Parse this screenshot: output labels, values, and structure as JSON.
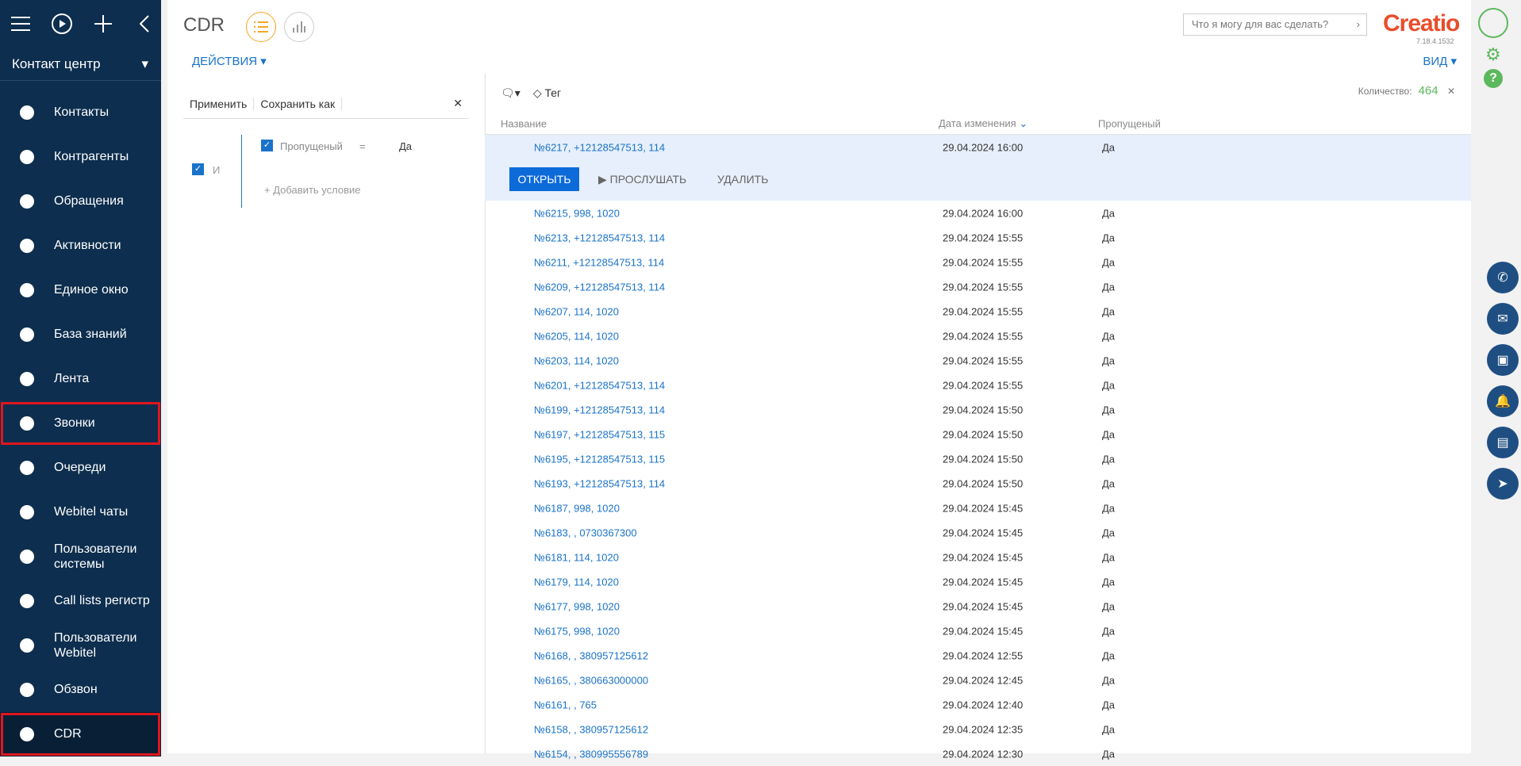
{
  "workspace": "Контакт центр",
  "nav": [
    {
      "label": "Контакты",
      "icon": "person-icon"
    },
    {
      "label": "Контрагенты",
      "icon": "building-icon"
    },
    {
      "label": "Обращения",
      "icon": "exclamation-icon"
    },
    {
      "label": "Активности",
      "icon": "flag-icon"
    },
    {
      "label": "Единое окно",
      "icon": "person-window-icon"
    },
    {
      "label": "База знаний",
      "icon": "book-icon"
    },
    {
      "label": "Лента",
      "icon": "chat-icon"
    },
    {
      "label": "Звонки",
      "icon": "phone-icon"
    },
    {
      "label": "Очереди",
      "icon": "queue-icon"
    },
    {
      "label": "Webitel чаты",
      "icon": "send-icon"
    },
    {
      "label": "Пользователи системы",
      "icon": "user-icon"
    },
    {
      "label": "Call lists регистр",
      "icon": "phone-list-icon"
    },
    {
      "label": "Пользователи Webitel",
      "icon": "users-icon"
    },
    {
      "label": "Обзвон",
      "icon": "dial-icon"
    },
    {
      "label": "CDR",
      "icon": "cdr-icon"
    }
  ],
  "page": {
    "title": "CDR",
    "actions": "ДЕЙСТВИЯ",
    "view": "ВИД",
    "search_placeholder": "Что я могу для вас сделать?",
    "logo": "Creatio",
    "version": "7.18.4.1532"
  },
  "filter": {
    "apply": "Применить",
    "save_as": "Сохранить как",
    "cond_field": "Пропущеный",
    "cond_op": "=",
    "cond_value": "Да",
    "group": "И",
    "add": "Добавить условие"
  },
  "grid": {
    "tag": "Тег",
    "count_label": "Количество:",
    "count": "464",
    "cols": [
      "Название",
      "Дата изменения",
      "Пропущеный"
    ],
    "open": "ОТКРЫТЬ",
    "listen": "ПРОСЛУШАТЬ",
    "delete": "УДАЛИТЬ",
    "rows": [
      [
        "№6217, +12128547513, 114",
        "29.04.2024 16:00",
        "Да"
      ],
      [
        "№6215, 998, 1020",
        "29.04.2024 16:00",
        "Да"
      ],
      [
        "№6213, +12128547513, 114",
        "29.04.2024 15:55",
        "Да"
      ],
      [
        "№6211, +12128547513, 114",
        "29.04.2024 15:55",
        "Да"
      ],
      [
        "№6209, +12128547513, 114",
        "29.04.2024 15:55",
        "Да"
      ],
      [
        "№6207, 114, 1020",
        "29.04.2024 15:55",
        "Да"
      ],
      [
        "№6205, 114, 1020",
        "29.04.2024 15:55",
        "Да"
      ],
      [
        "№6203, 114, 1020",
        "29.04.2024 15:55",
        "Да"
      ],
      [
        "№6201, +12128547513, 114",
        "29.04.2024 15:55",
        "Да"
      ],
      [
        "№6199, +12128547513, 114",
        "29.04.2024 15:50",
        "Да"
      ],
      [
        "№6197, +12128547513, 115",
        "29.04.2024 15:50",
        "Да"
      ],
      [
        "№6195, +12128547513, 115",
        "29.04.2024 15:50",
        "Да"
      ],
      [
        "№6193, +12128547513, 114",
        "29.04.2024 15:50",
        "Да"
      ],
      [
        "№6187, 998, 1020",
        "29.04.2024 15:45",
        "Да"
      ],
      [
        "№6183, , 0730367300",
        "29.04.2024 15:45",
        "Да"
      ],
      [
        "№6181, 114, 1020",
        "29.04.2024 15:45",
        "Да"
      ],
      [
        "№6179, 114, 1020",
        "29.04.2024 15:45",
        "Да"
      ],
      [
        "№6177, 998, 1020",
        "29.04.2024 15:45",
        "Да"
      ],
      [
        "№6175, 998, 1020",
        "29.04.2024 15:45",
        "Да"
      ],
      [
        "№6168, , 380957125612",
        "29.04.2024 12:55",
        "Да"
      ],
      [
        "№6165, , 380663000000",
        "29.04.2024 12:45",
        "Да"
      ],
      [
        "№6161, , 765",
        "29.04.2024 12:40",
        "Да"
      ],
      [
        "№6158, , 380957125612",
        "29.04.2024 12:35",
        "Да"
      ],
      [
        "№6154, , 380995556789",
        "29.04.2024 12:30",
        "Да"
      ]
    ]
  }
}
